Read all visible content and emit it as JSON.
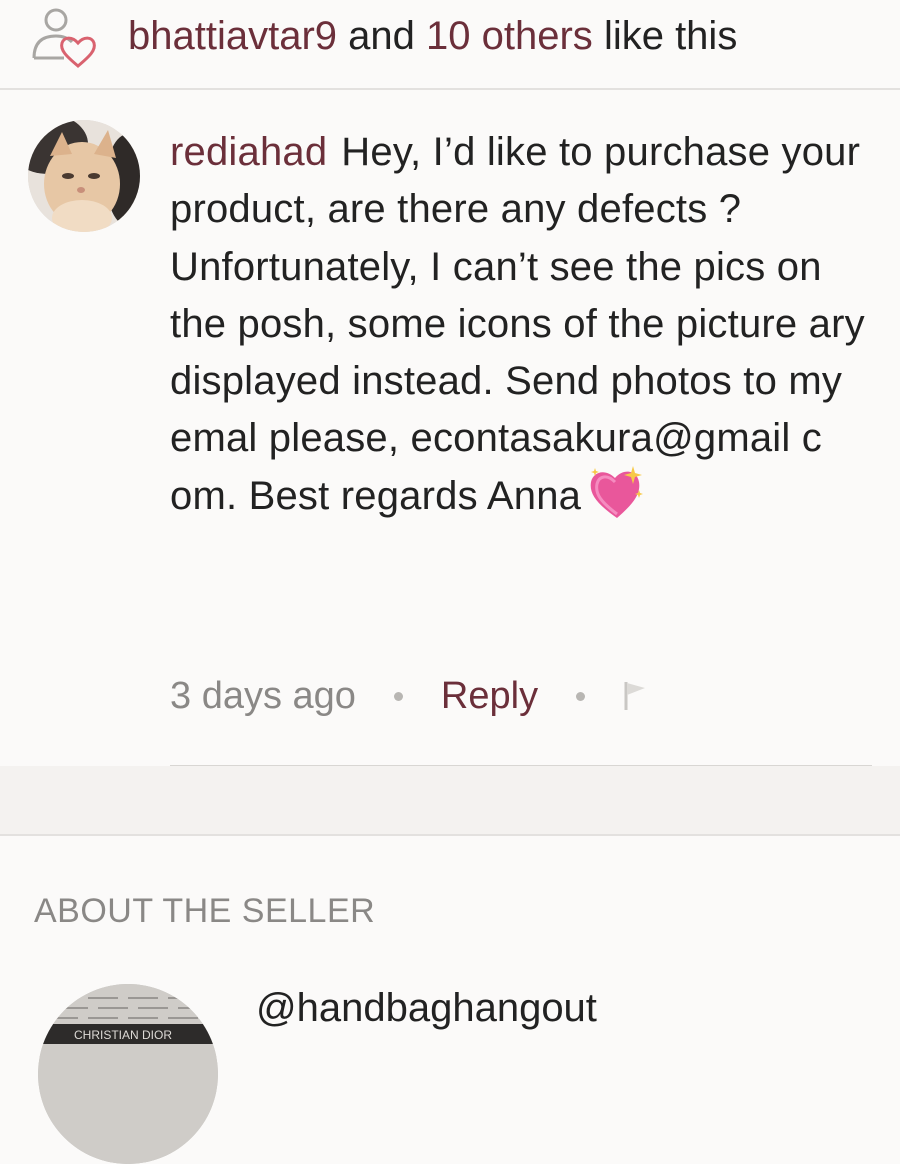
{
  "likes": {
    "user": "bhattiavtar9",
    "and_text": "and",
    "others_count": "10 others",
    "suffix": "like this"
  },
  "comment": {
    "username": "rediahad",
    "text": "Hey, I’d like to purchase your product, are there any defects ? Unfortunately, I can’t see the pics on the posh, some icons of the picture ary displayed instead. Send photos to my emal please, econtasakura@gmail c om. Best regards Anna",
    "time": "3 days ago",
    "reply_label": "Reply",
    "emoji": "sparkling-heart"
  },
  "seller": {
    "section_title": "ABOUT THE SELLER",
    "handle": "@handbaghangout",
    "avatar_text": "CHRISTIAN DIOR"
  },
  "colors": {
    "accent": "#6b2f3a",
    "muted": "#8a8886",
    "background": "#fbfaf9"
  }
}
